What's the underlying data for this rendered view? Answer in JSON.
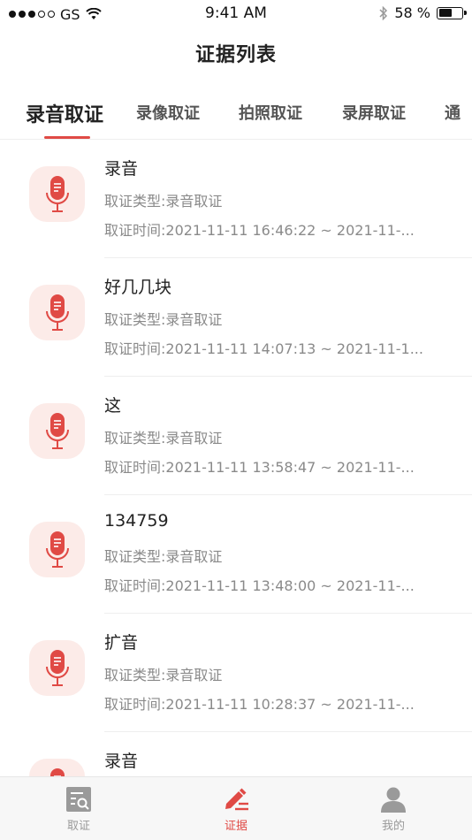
{
  "status_bar": {
    "carrier": "GS",
    "time": "9:41 AM",
    "battery_text": "58 %",
    "battery_level": 0.58
  },
  "header": {
    "title": "证据列表"
  },
  "tabs": [
    {
      "label": "录音取证",
      "active": true
    },
    {
      "label": "录像取证",
      "active": false
    },
    {
      "label": "拍照取证",
      "active": false
    },
    {
      "label": "录屏取证",
      "active": false
    },
    {
      "label": "通",
      "active": false
    }
  ],
  "colors": {
    "accent": "#e04a45",
    "icon_bg": "#fcebe8",
    "muted_text": "#8a8a8a"
  },
  "evidence_list": [
    {
      "title": "录音",
      "type": "取证类型:录音取证",
      "time": "取证时间:2021-11-11 16:46:22 ~ 2021-11-...",
      "icon": "microphone-icon"
    },
    {
      "title": "好几几块",
      "type": "取证类型:录音取证",
      "time": "取证时间:2021-11-11 14:07:13 ~ 2021-11-1...",
      "icon": "microphone-icon"
    },
    {
      "title": "这",
      "type": "取证类型:录音取证",
      "time": "取证时间:2021-11-11 13:58:47 ~ 2021-11-...",
      "icon": "microphone-icon"
    },
    {
      "title": "134759",
      "type": "取证类型:录音取证",
      "time": "取证时间:2021-11-11 13:48:00 ~ 2021-11-...",
      "icon": "microphone-icon"
    },
    {
      "title": "扩音",
      "type": "取证类型:录音取证",
      "time": "取证时间:2021-11-11 10:28:37 ~ 2021-11-...",
      "icon": "microphone-icon"
    },
    {
      "title": "录音",
      "type": "",
      "time": "",
      "icon": "microphone-icon"
    }
  ],
  "bottom_nav": [
    {
      "label": "取证",
      "icon": "search-document-icon",
      "active": false
    },
    {
      "label": "证据",
      "icon": "edit-pen-icon",
      "active": true
    },
    {
      "label": "我的",
      "icon": "user-icon",
      "active": false
    }
  ]
}
